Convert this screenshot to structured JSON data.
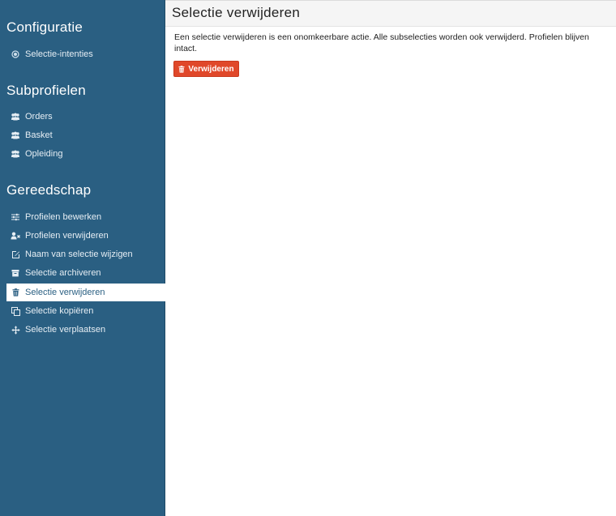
{
  "sidebar": {
    "sections": [
      {
        "title": "Configuratie"
      },
      {
        "title": "Subprofielen"
      },
      {
        "title": "Gereedschap"
      }
    ],
    "configuratie_items": [
      {
        "label": "Selectie-intenties",
        "icon": "dot-circle-icon"
      }
    ],
    "subprofielen_items": [
      {
        "label": "Orders",
        "icon": "users-icon"
      },
      {
        "label": "Basket",
        "icon": "users-icon"
      },
      {
        "label": "Opleiding",
        "icon": "users-icon"
      }
    ],
    "gereedschap_items": [
      {
        "label": "Profielen bewerken",
        "icon": "sliders-icon"
      },
      {
        "label": "Profielen verwijderen",
        "icon": "user-times-icon"
      },
      {
        "label": "Naam van selectie wijzigen",
        "icon": "edit-icon"
      },
      {
        "label": "Selectie archiveren",
        "icon": "archive-icon"
      },
      {
        "label": "Selectie verwijderen",
        "icon": "trash-icon",
        "active": true
      },
      {
        "label": "Selectie kopiëren",
        "icon": "copy-icon"
      },
      {
        "label": "Selectie verplaatsen",
        "icon": "move-icon"
      }
    ]
  },
  "main": {
    "title": "Selectie verwijderen",
    "description": "Een selectie verwijderen is een onomkeerbare actie. Alle subselecties worden ook verwijderd. Profielen blijven intact.",
    "delete_button_label": "Verwijderen"
  },
  "colors": {
    "sidebar_bg": "#2a5f82",
    "danger": "#e0482a",
    "header_bg": "#f5f5f5"
  }
}
